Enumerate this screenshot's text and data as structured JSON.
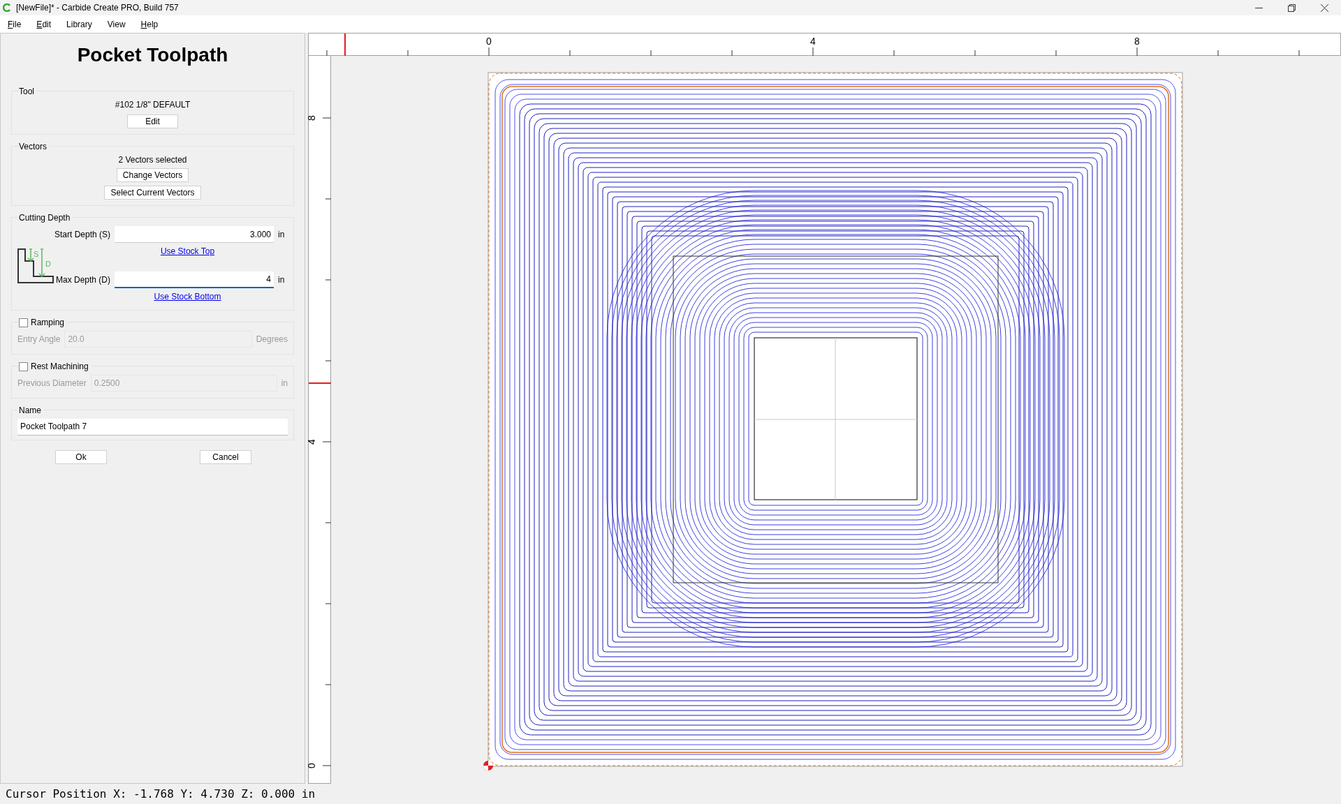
{
  "window": {
    "title": "[NewFile]* - Carbide Create PRO, Build 757"
  },
  "menu": [
    {
      "label": "File",
      "mnemonic": true
    },
    {
      "label": "Edit",
      "mnemonic": true
    },
    {
      "label": "Library",
      "mnemonic": false
    },
    {
      "label": "View",
      "mnemonic": false
    },
    {
      "label": "Help",
      "mnemonic": true
    }
  ],
  "panel": {
    "title": "Pocket Toolpath",
    "tool": {
      "heading": "Tool",
      "name": "#102 1/8\" DEFAULT",
      "button": "Edit"
    },
    "vectors": {
      "heading": "Vectors",
      "summary": "2 Vectors selected",
      "buttons": [
        "Change Vectors",
        "Select Current Vectors"
      ]
    },
    "cutting_depth": {
      "heading": "Cutting Depth",
      "diagram_labels": [
        "S",
        "D"
      ],
      "start": {
        "label": "Start Depth (S)",
        "value": "3.000",
        "unit": "in",
        "link": "Use Stock Top",
        "focused": false
      },
      "max": {
        "label": "Max Depth (D)",
        "value": "4",
        "unit": "in",
        "link": "Use Stock Bottom",
        "focused": true
      }
    },
    "ramping": {
      "label": "Ramping",
      "checked": false,
      "field_label": "Entry Angle",
      "value": "20.0",
      "unit": "Degrees",
      "disabled": true
    },
    "rest_machining": {
      "label": "Rest Machining",
      "checked": false,
      "field_label": "Previous Diameter",
      "value": "0.2500",
      "unit": "in",
      "disabled": true
    },
    "name": {
      "heading": "Name",
      "value": "Pocket Toolpath 7"
    },
    "buttons": [
      "Ok",
      "Cancel"
    ]
  },
  "rulers": {
    "top_labels": [
      "0",
      "4",
      "8"
    ],
    "left_labels": [
      "8",
      "4",
      "0"
    ]
  },
  "status_bar": "Cursor Position X: -1.768 Y: 4.730 Z: 0.000 in"
}
